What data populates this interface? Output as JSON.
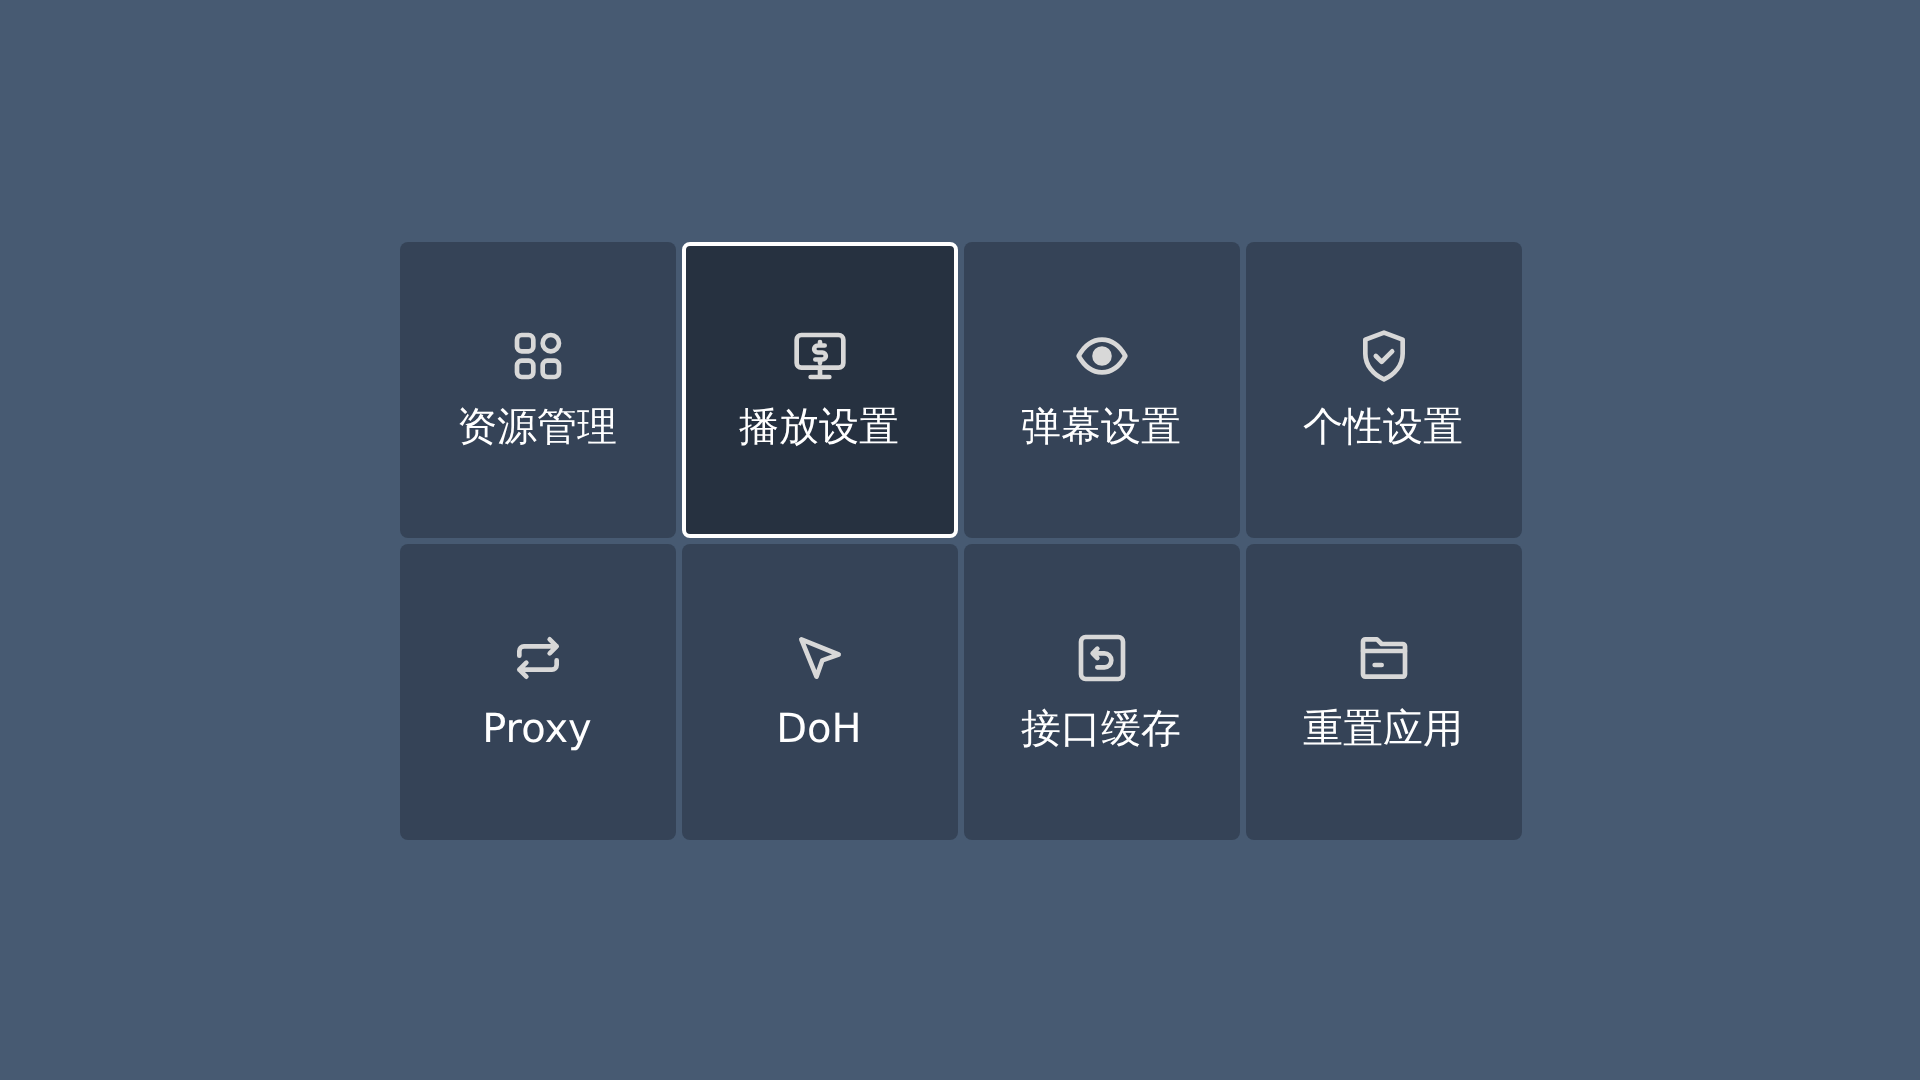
{
  "tiles": [
    {
      "label": "资源管理",
      "selected": false
    },
    {
      "label": "播放设置",
      "selected": true
    },
    {
      "label": "弹幕设置",
      "selected": false
    },
    {
      "label": "个性设置",
      "selected": false
    },
    {
      "label": "Proxy",
      "selected": false
    },
    {
      "label": "DoH",
      "selected": false
    },
    {
      "label": "接口缓存",
      "selected": false
    },
    {
      "label": "重置应用",
      "selected": false
    }
  ]
}
